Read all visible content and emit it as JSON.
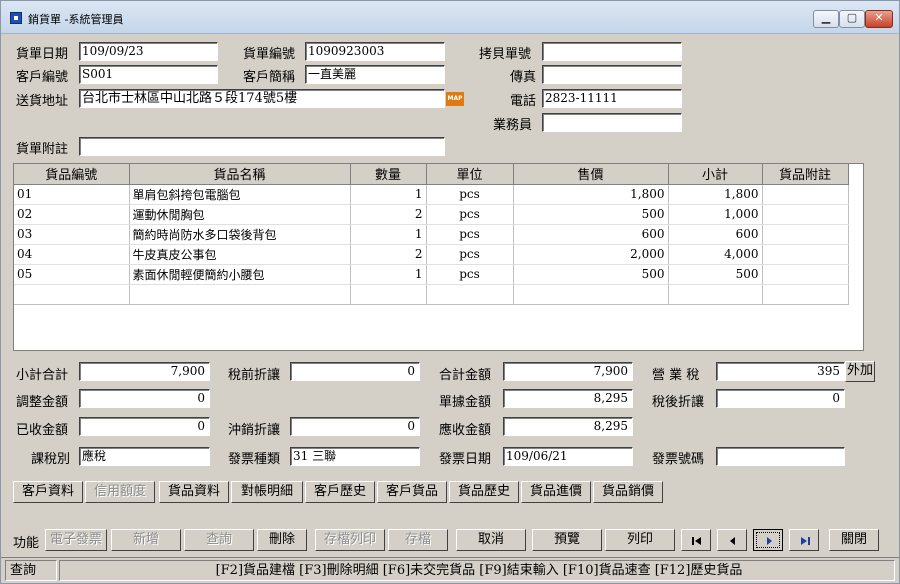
{
  "window": {
    "title": "銷貨單 -系統管理員",
    "min_symbol": "▁",
    "max_symbol": "▢",
    "close_symbol": "✕"
  },
  "header": {
    "doc_date_label": "貨單日期",
    "doc_date": "109/09/23",
    "doc_no_label": "貨單編號",
    "doc_no": "1090923003",
    "copy_no_label": "拷貝單號",
    "copy_no": "",
    "cust_code_label": "客戶編號",
    "cust_code": "S001",
    "cust_name_label": "客戶簡稱",
    "cust_name": "一直美麗",
    "fax_label": "傳真",
    "fax": "",
    "address_label": "送貨地址",
    "address": "台北市士林區中山北路５段174號5樓",
    "map_icon": "map-icon",
    "map_text": "MAP",
    "phone_label": "電話",
    "phone": "2823-11111",
    "sales_label": "業務員",
    "sales": "",
    "note_label": "貨單附註",
    "note": ""
  },
  "grid": {
    "columns": [
      "貨品編號",
      "貨品名稱",
      "數量",
      "單位",
      "售價",
      "小計",
      "貨品附註"
    ],
    "rows": [
      {
        "code": "01",
        "name": "單肩包斜挎包電腦包",
        "qty": "1",
        "unit": "pcs",
        "price": "1,800",
        "subtotal": "1,800",
        "note": ""
      },
      {
        "code": "02",
        "name": "運動休閒胸包",
        "qty": "2",
        "unit": "pcs",
        "price": "500",
        "subtotal": "1,000",
        "note": ""
      },
      {
        "code": "03",
        "name": "簡約時尚防水多口袋後背包",
        "qty": "1",
        "unit": "pcs",
        "price": "600",
        "subtotal": "600",
        "note": ""
      },
      {
        "code": "04",
        "name": "牛皮真皮公事包",
        "qty": "2",
        "unit": "pcs",
        "price": "2,000",
        "subtotal": "4,000",
        "note": ""
      },
      {
        "code": "05",
        "name": "素面休閒輕便簡約小腰包",
        "qty": "1",
        "unit": "pcs",
        "price": "500",
        "subtotal": "500",
        "note": ""
      }
    ]
  },
  "totals": {
    "subtotal_sum_label": "小計合計",
    "subtotal_sum": "7,900",
    "pretax_discount_label": "稅前折讓",
    "pretax_discount": "0",
    "total_amount_label": "合計金額",
    "total_amount": "7,900",
    "business_tax_label": "營 業 稅",
    "business_tax": "395",
    "tax_mode_button": "外加",
    "adjust_amount_label": "調整金額",
    "adjust_amount": "0",
    "doc_amount_label": "單據金額",
    "doc_amount": "8,295",
    "aftertax_discount_label": "稅後折讓",
    "aftertax_discount": "0",
    "received_label": "已收金額",
    "received": "0",
    "offset_discount_label": "沖銷折讓",
    "offset_discount": "0",
    "receivable_label": "應收金額",
    "receivable": "8,295",
    "tax_type_label": "課稅別",
    "tax_type": "應稅",
    "invoice_type_label": "發票種類",
    "invoice_type": "31 三聯",
    "invoice_date_label": "發票日期",
    "invoice_date": "109/06/21",
    "invoice_no_label": "發票號碼",
    "invoice_no": ""
  },
  "tabs": [
    "客戶資料",
    "信用額度",
    "貨品資料",
    "對帳明細",
    "客戶歷史",
    "客戶貨品",
    "貨品歷史",
    "貨品進價",
    "貨品銷價"
  ],
  "functions": {
    "label": "功能",
    "e_invoice": "電子發票",
    "add": "新增",
    "query": "查詢",
    "delete": "刪除",
    "save_print": "存檔列印",
    "save": "存檔",
    "cancel": "取消",
    "preview": "預覽",
    "print": "列印",
    "close": "關閉"
  },
  "status": {
    "mode": "查詢",
    "hints": "[F2]貨品建檔 [F3]刪除明細 [F6]未交完貨品 [F9]結束輸入 [F10]貨品速查 [F12]歷史貨品"
  }
}
